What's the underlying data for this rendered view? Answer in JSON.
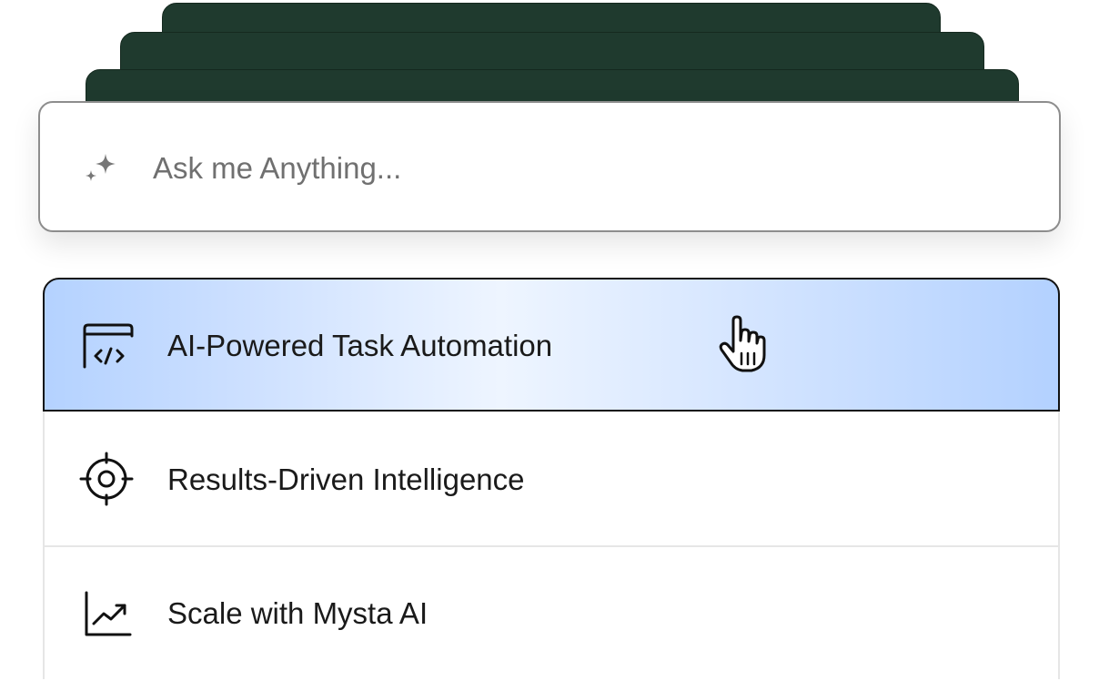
{
  "search": {
    "placeholder": "Ask me Anything...",
    "icon": "sparkle-icon"
  },
  "features": [
    {
      "label": "AI-Powered Task Automation",
      "icon": "code-window-icon",
      "state": "hovered"
    },
    {
      "label": "Results-Driven Intelligence",
      "icon": "target-icon"
    },
    {
      "label": "Scale with Mysta AI",
      "icon": "trending-chart-icon"
    }
  ],
  "colors": {
    "stack_card": "#1f3a2e",
    "active_gradient_start": "#b4d2ff",
    "active_gradient_mid": "#eef5ff",
    "text": "#1a1a1a",
    "placeholder": "#707070"
  },
  "cursor": "pointer-hand-icon"
}
